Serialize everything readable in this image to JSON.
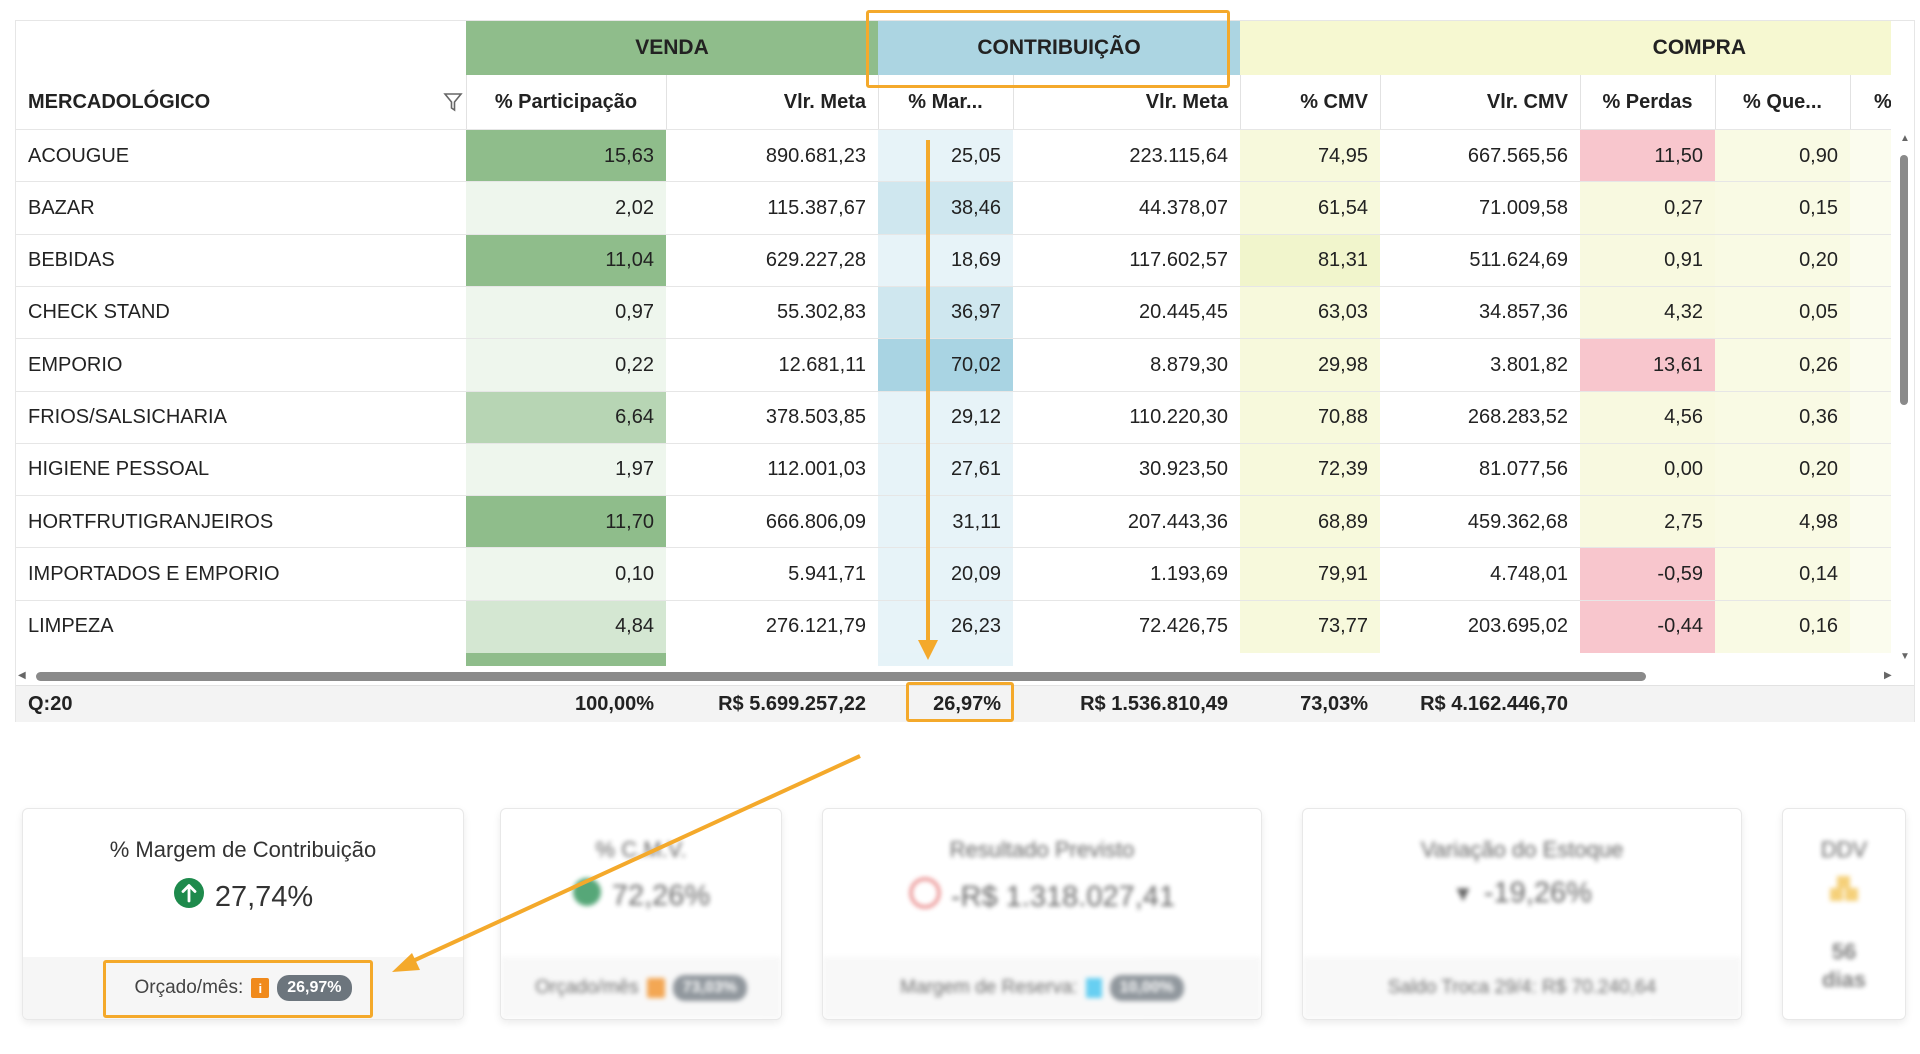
{
  "groups": {
    "venda": "VENDA",
    "contribuicao": "CONTRIBUIÇÃO",
    "compra": "COMPRA"
  },
  "columns": {
    "merc": "MERCADOLÓGICO",
    "participacao": "% Participação",
    "vlr_meta": "Vlr. Meta",
    "margem": "% Mar...",
    "vlr_meta2": "Vlr. Meta",
    "cmv": "% CMV",
    "vlr_cmv": "Vlr. CMV",
    "perdas": "% Perdas",
    "que": "% Que...",
    "extra": "%"
  },
  "rows": [
    {
      "name": "ACOUGUE",
      "participacao": "15,63",
      "vlr_meta": "890.681,23",
      "margem": "25,05",
      "vlr_meta2": "223.115,64",
      "cmv": "74,95",
      "vlr_cmv": "667.565,56",
      "perdas": "11,50",
      "que": "0,90"
    },
    {
      "name": "BAZAR",
      "participacao": "2,02",
      "vlr_meta": "115.387,67",
      "margem": "38,46",
      "vlr_meta2": "44.378,07",
      "cmv": "61,54",
      "vlr_cmv": "71.009,58",
      "perdas": "0,27",
      "que": "0,15"
    },
    {
      "name": "BEBIDAS",
      "participacao": "11,04",
      "vlr_meta": "629.227,28",
      "margem": "18,69",
      "vlr_meta2": "117.602,57",
      "cmv": "81,31",
      "vlr_cmv": "511.624,69",
      "perdas": "0,91",
      "que": "0,20"
    },
    {
      "name": "CHECK STAND",
      "participacao": "0,97",
      "vlr_meta": "55.302,83",
      "margem": "36,97",
      "vlr_meta2": "20.445,45",
      "cmv": "63,03",
      "vlr_cmv": "34.857,36",
      "perdas": "4,32",
      "que": "0,05"
    },
    {
      "name": "EMPORIO",
      "participacao": "0,22",
      "vlr_meta": "12.681,11",
      "margem": "70,02",
      "vlr_meta2": "8.879,30",
      "cmv": "29,98",
      "vlr_cmv": "3.801,82",
      "perdas": "13,61",
      "que": "0,26"
    },
    {
      "name": "FRIOS/SALSICHARIA",
      "participacao": "6,64",
      "vlr_meta": "378.503,85",
      "margem": "29,12",
      "vlr_meta2": "110.220,30",
      "cmv": "70,88",
      "vlr_cmv": "268.283,52",
      "perdas": "4,56",
      "que": "0,36"
    },
    {
      "name": "HIGIENE PESSOAL",
      "participacao": "1,97",
      "vlr_meta": "112.001,03",
      "margem": "27,61",
      "vlr_meta2": "30.923,50",
      "cmv": "72,39",
      "vlr_cmv": "81.077,56",
      "perdas": "0,00",
      "que": "0,20"
    },
    {
      "name": "HORTFRUTIGRANJEIROS",
      "participacao": "11,70",
      "vlr_meta": "666.806,09",
      "margem": "31,11",
      "vlr_meta2": "207.443,36",
      "cmv": "68,89",
      "vlr_cmv": "459.362,68",
      "perdas": "2,75",
      "que": "4,98"
    },
    {
      "name": "IMPORTADOS E EMPORIO",
      "participacao": "0,10",
      "vlr_meta": "5.941,71",
      "margem": "20,09",
      "vlr_meta2": "1.193,69",
      "cmv": "79,91",
      "vlr_cmv": "4.748,01",
      "perdas": "-0,59",
      "que": "0,14"
    },
    {
      "name": "LIMPEZA",
      "participacao": "4,84",
      "vlr_meta": "276.121,79",
      "margem": "26,23",
      "vlr_meta2": "72.426,75",
      "cmv": "73,77",
      "vlr_cmv": "203.695,02",
      "perdas": "-0,44",
      "que": "0,16"
    }
  ],
  "footer": {
    "count": "Q:20",
    "participacao": "100,00%",
    "vlr_meta": "R$ 5.699.257,22",
    "margem": "26,97%",
    "vlr_meta2": "R$ 1.536.810,49",
    "cmv": "73,03%",
    "vlr_cmv": "R$ 4.162.446,70"
  },
  "cards": {
    "margem": {
      "title": "% Margem de Contribuição",
      "value": "27,74%",
      "foot_label": "Orçado/mês:",
      "foot_info": "i",
      "foot_badge": "26,97%",
      "icon": "arrow-up-circle-icon"
    },
    "cmv": {
      "title": "% C.M.V.",
      "value": "72,26%",
      "foot_label": "Orçado/mês",
      "foot_badge": "73,03%"
    },
    "resultado": {
      "title": "Resultado Previsto",
      "value": "-R$ 1.318.027,41",
      "foot_label": "Margem de Reserva:",
      "foot_badge": "10,00%"
    },
    "estoque": {
      "title": "Variação do Estoque",
      "value": "-19,26%",
      "foot_label": "Saldo Troca 29/4: R$ 70.240,64"
    },
    "ddv": {
      "title": "DDV",
      "value": "56",
      "unit": "dias"
    }
  },
  "colors": {
    "venda_header": "#8fbd8b",
    "contribuicao_header": "#acd5e2",
    "compra_header": "#f6f8d1",
    "perdas_alert": "#f8c6cd",
    "highlight_orange": "#f4a92b"
  }
}
